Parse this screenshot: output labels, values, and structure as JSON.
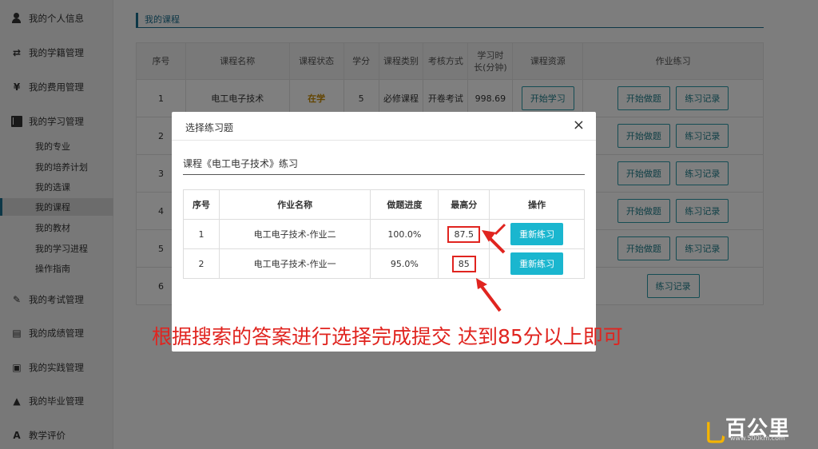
{
  "sidebar": {
    "items": [
      {
        "label": "我的个人信息",
        "icon": "user-icon"
      },
      {
        "label": "我的学籍管理",
        "icon": "transfer-icon"
      },
      {
        "label": "我的费用管理",
        "icon": "yen-icon"
      },
      {
        "label": "我的学习管理",
        "icon": "book-icon"
      }
    ],
    "sub_items": [
      "我的专业",
      "我的培养计划",
      "我的选课",
      "我的课程",
      "我的教材",
      "我的学习进程",
      "操作指南"
    ],
    "active_sub": "我的课程",
    "items_bottom": [
      {
        "label": "我的考试管理",
        "icon": "edit-icon"
      },
      {
        "label": "我的成绩管理",
        "icon": "books-icon"
      },
      {
        "label": "我的实践管理",
        "icon": "id-card-icon"
      },
      {
        "label": "我的毕业管理",
        "icon": "graduation-cap-icon"
      },
      {
        "label": "教学评价",
        "icon": "font-icon"
      }
    ]
  },
  "page": {
    "title": "我的课程",
    "columns": [
      "序号",
      "课程名称",
      "课程状态",
      "学分",
      "课程类别",
      "考核方式",
      "学习时长(分钟)",
      "课程资源",
      "作业练习"
    ],
    "first_row": {
      "index": "1",
      "name": "电工电子技术",
      "status": "在学",
      "credit": "5",
      "category": "必修课程",
      "exam": "开卷考试",
      "duration": "998.69",
      "resource_btn": "开始学习"
    },
    "row_indexes": [
      "2",
      "3",
      "4",
      "5",
      "6"
    ],
    "start_practice_label": "开始做题",
    "practice_record_label": "练习记录"
  },
  "modal": {
    "title": "选择练习题",
    "close_glyph": "×",
    "course_line": "课程《电工电子技术》练习",
    "columns": [
      "序号",
      "作业名称",
      "做题进度",
      "最高分",
      "操作"
    ],
    "rows": [
      {
        "index": "1",
        "name": "电工电子技术-作业二",
        "progress": "100.0%",
        "score": "87.5",
        "action": "重新练习"
      },
      {
        "index": "2",
        "name": "电工电子技术-作业一",
        "progress": "95.0%",
        "score": "85",
        "action": "重新练习"
      }
    ]
  },
  "annotation": {
    "hint": "根据搜索的答案进行选择完成提交 达到85分以上即可",
    "color": "#e0241f"
  },
  "watermark": {
    "brand": "百公里",
    "url": "www.500km.com"
  }
}
